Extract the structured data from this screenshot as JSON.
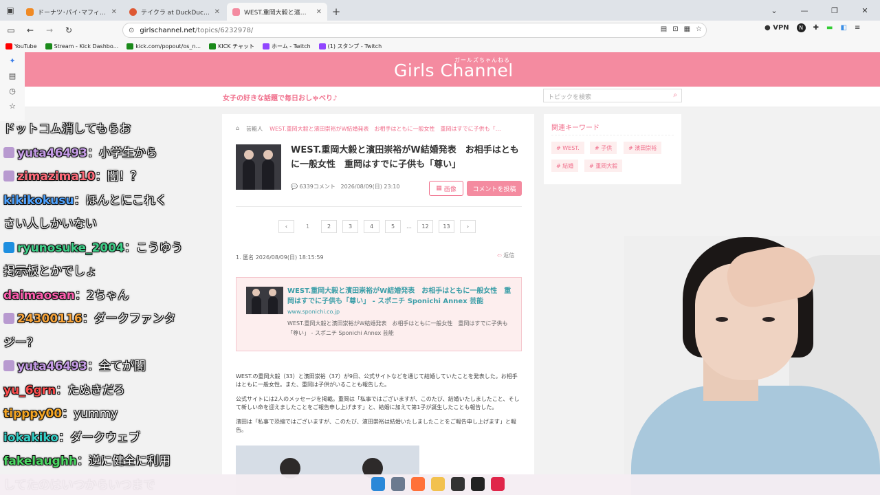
{
  "browser": {
    "tabs": [
      {
        "title": "ドーナツ･パイ･マフィン｜メニュー｜ミ",
        "color": "#f08a24"
      },
      {
        "title": "テイクラ at DuckDuckGo",
        "color": "#de5833"
      },
      {
        "title": "WEST.重岡大毅と濱田崇裕がW結",
        "color": "#f48ba0"
      }
    ],
    "url_host": "girlschannel.net",
    "url_path": "/topics/6232978/",
    "vpn_label": "VPN",
    "profile_letter": "N",
    "bookmarks": [
      {
        "label": "YouTube",
        "color": "#ff0000"
      },
      {
        "label": "Stream - Kick Dashbo...",
        "color": "#1a8a1a"
      },
      {
        "label": "kick.com/popout/os_n...",
        "color": "#1a8a1a"
      },
      {
        "label": "KICK チャット",
        "color": "#1a8a1a"
      },
      {
        "label": "ホーム - Twitch",
        "color": "#9146ff"
      },
      {
        "label": "(1) スタンプ - Twitch",
        "color": "#9146ff"
      }
    ]
  },
  "site": {
    "logo": "Girls Channel",
    "logo_sub": "ガールズちゃんねる",
    "tagline": "女子の好きな話題で毎日おしゃべり♪",
    "search_placeholder": "トピックを検索"
  },
  "topic": {
    "breadcrumb_category": "芸能人",
    "breadcrumb_current": "WEST.重岡大毅と濱田崇裕がW結婚発表　お相手はともに一般女性　重岡はすでに子供も「…",
    "title": "WEST.重岡大毅と濱田崇裕がW結婚発表　お相手はともに一般女性　重岡はすでに子供も「尊い」",
    "comment_count": "6339コメント",
    "date": "2026/08/09(日) 23:10",
    "image_button": "画像",
    "post_button": "コメントを投稿",
    "pages": [
      "‹",
      "1",
      "2",
      "3",
      "4",
      "5",
      "…",
      "12",
      "13",
      "›"
    ],
    "comment_header": "1. 匿名 2026/08/09(日) 18:15:59",
    "reply_label": "返信",
    "card_title": "WEST.重岡大毅と濱田崇裕がW結婚発表　お相手はともに一般女性　重岡はすでに子供も「尊い」 - スポニチ Sponichi Annex 芸能",
    "card_host": "www.sponichi.co.jp",
    "card_desc": "WEST.重岡大毅と濱田崇裕がW結婚発表　お相手はともに一般女性　重岡はすでに子供も「尊い」 - スポニチ Sponichi Annex 芸能",
    "paragraphs": [
      "WEST.の重岡大毅（33）と濱田崇裕（37）が9日、公式サイトなどを通じて結婚していたことを発表した。お相手はともに一般女性。また、重岡は子供がいることも報告した。",
      "公式サイトには2人のメッセージを掲載。重岡は「私事ではございますが、このたび、結婚いたしましたこと、そして新しい命を迎えましたことをご報告申し上げます」と、結婚に加えて第1子が誕生したことも報告した。",
      "濱田は「私事で恐縮ではございますが、このたび、濱田崇裕は結婚いたしましたことをご報告申し上げます」と報告。"
    ]
  },
  "keywords": {
    "title": "関連キーワード",
    "tags": [
      "# WEST.",
      "# 子供",
      "# 濱田崇裕",
      "# 結婚",
      "# 重岡大毅"
    ]
  },
  "chat": [
    {
      "name": "",
      "text": "ドットコム消してもらお",
      "color": "#ffffff",
      "badge": "none"
    },
    {
      "name": "yuta46493",
      "text": "：小学生から",
      "color": "#c49ae6",
      "badge": "emote"
    },
    {
      "name": "zimazima10",
      "text": "：闇！？",
      "color": "#ff6b7a",
      "badge": "emote"
    },
    {
      "name": "kikikokusu",
      "text": "：ほんとにこれく",
      "color": "#4fa3ff",
      "badge": "none"
    },
    {
      "name": "",
      "text": "さい人しかいない",
      "color": "#ffffff",
      "badge": "none"
    },
    {
      "name": "ryunosuke_2004",
      "text": "：こうゆう",
      "color": "#3fd18a",
      "badge": "cube"
    },
    {
      "name": "",
      "text": "掲示板とかでしょ",
      "color": "#ffffff",
      "badge": "none"
    },
    {
      "name": "daimaosan",
      "text": "：2ちゃん",
      "color": "#ff5fb0",
      "badge": "none"
    },
    {
      "name": "24300116",
      "text": "：ダークファンタ",
      "color": "#f6a33a",
      "badge": "emote"
    },
    {
      "name": "",
      "text": "ジー？",
      "color": "#ffffff",
      "badge": "none"
    },
    {
      "name": "yuta46493",
      "text": "：全てが闇",
      "color": "#c49ae6",
      "badge": "emote"
    },
    {
      "name": "yu_6grn",
      "text": "：たぬきだろ",
      "color": "#ff4d4d",
      "badge": "none"
    },
    {
      "name": "tipppy00",
      "text": "：yummy",
      "color": "#f5a623",
      "badge": "none"
    },
    {
      "name": "iokakiko",
      "text": "：ダークウェブ",
      "color": "#35d0c8",
      "badge": "none"
    },
    {
      "name": "fakelaughh",
      "text": "：逆に健全に利用",
      "color": "#4cd964",
      "badge": "none"
    },
    {
      "name": "",
      "text": "してたのはいつからいつまで",
      "color": "#ffffff",
      "badge": "none"
    }
  ],
  "taskbar_icons": [
    {
      "name": "windows-start-icon",
      "color": "#2b88d8"
    },
    {
      "name": "settings-icon",
      "color": "#6b7a8f"
    },
    {
      "name": "firefox-icon",
      "color": "#ff7139"
    },
    {
      "name": "file-explorer-icon",
      "color": "#f2c14e"
    },
    {
      "name": "app-icon",
      "color": "#333333"
    },
    {
      "name": "obs-icon",
      "color": "#222222"
    },
    {
      "name": "app-red-icon",
      "color": "#e0264a"
    }
  ]
}
